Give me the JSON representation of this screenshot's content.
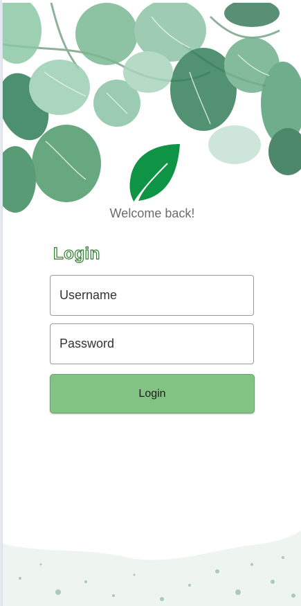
{
  "app": {
    "welcome_text": "Welcome back!",
    "login_heading": "Login"
  },
  "form": {
    "username_placeholder": "Username",
    "password_placeholder": "Password",
    "submit_label": "Login"
  },
  "colors": {
    "brand_green": "#0f9445",
    "button_green": "#82c384",
    "heading_outline": "#2f7d2f"
  },
  "icons": {
    "logo": "leaf-icon"
  }
}
